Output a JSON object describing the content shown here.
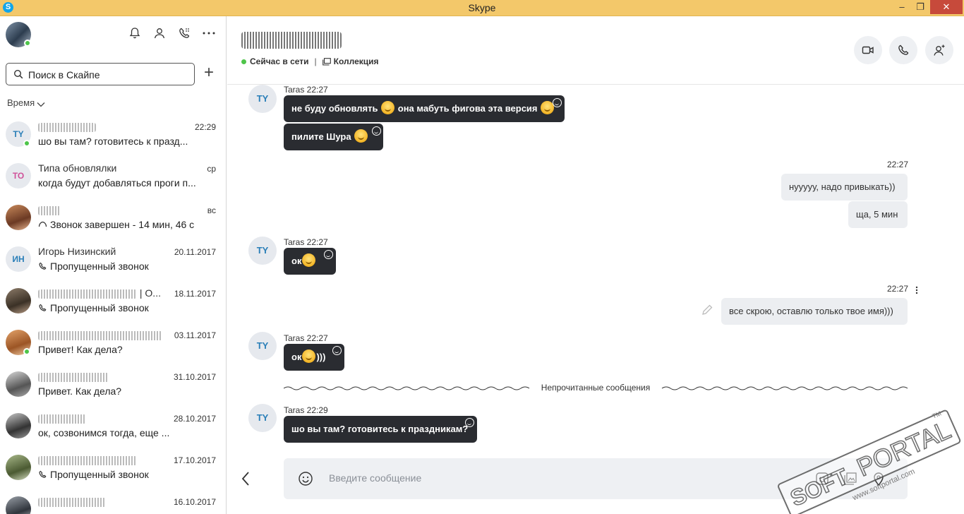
{
  "window": {
    "title": "Skype",
    "app_icon": "S",
    "minimize": "–",
    "maximize": "❐",
    "close": "✕"
  },
  "sidebar": {
    "search_placeholder": "Поиск в Скайпе",
    "add_label": "+",
    "sort_label": "Время",
    "chats": [
      {
        "initials": "TY",
        "name": "",
        "preview": "шо вы там? готовитесь к празд...",
        "time": "22:29",
        "online": true
      },
      {
        "initials": "ТО",
        "name": "Типа обновлялки",
        "preview": "когда будут добавляться проги п...",
        "time": "ср",
        "online": false
      },
      {
        "initials": "",
        "name": "",
        "preview": "Звонок завершен - 14 мин, 46 с",
        "time": "вс",
        "online": false
      },
      {
        "initials": "ИН",
        "name": "Игорь Низинский",
        "preview": "Пропущенный звонок",
        "time": "20.11.2017",
        "online": false
      },
      {
        "initials": "",
        "name": "| О...",
        "preview": "Пропущенный звонок",
        "time": "18.11.2017",
        "online": false
      },
      {
        "initials": "",
        "name": "",
        "preview": "Привет! Как дела?",
        "time": "03.11.2017",
        "online": true
      },
      {
        "initials": "",
        "name": "",
        "preview": "Привет. Как дела?",
        "time": "31.10.2017",
        "online": false
      },
      {
        "initials": "",
        "name": "",
        "preview": "ок, созвонимся тогда, еще ...",
        "time": "28.10.2017",
        "online": false
      },
      {
        "initials": "",
        "name": "",
        "preview": "Пропущенный звонок",
        "time": "17.10.2017",
        "online": false
      },
      {
        "initials": "",
        "name": "",
        "preview": "",
        "time": "16.10.2017",
        "online": false
      }
    ]
  },
  "header": {
    "status": "Сейчас в сети",
    "separator": "|",
    "collection": "Коллекция"
  },
  "messages": {
    "m1": {
      "initials": "TY",
      "meta": "Taras 22:27",
      "b1": "не буду обновлять",
      "b1b": "она мабуть фигова эта версия",
      "b2": "пилите Шура"
    },
    "m2": {
      "meta": "22:27",
      "b1": "нууууу, надо привыкать))",
      "b2": "ща, 5 мин"
    },
    "m3": {
      "initials": "TY",
      "meta": "Taras 22:27",
      "b1": "ок"
    },
    "m4": {
      "meta": "22:27",
      "b1": "все скрою, оставлю только твое имя)))"
    },
    "m5": {
      "initials": "TY",
      "meta": "Taras 22:27",
      "b1": "ок",
      "b1b": ")))"
    },
    "unread": "Непрочитанные сообщения",
    "m6": {
      "initials": "TY",
      "meta": "Taras 22:29",
      "b1": "шо вы там? готовитесь к праздникам?"
    }
  },
  "composer": {
    "placeholder": "Введите сообщение"
  },
  "watermark": {
    "text": "PORTAL",
    "prefix": "SOFT",
    "url": "www.softportal.com",
    "tm": "TM"
  },
  "colors": {
    "titlebar": "#f3c86a",
    "bubble_in": "#2a2c31",
    "bubble_out": "#eceef1",
    "online": "#4ec54a",
    "accent": "#2a7fb8"
  }
}
